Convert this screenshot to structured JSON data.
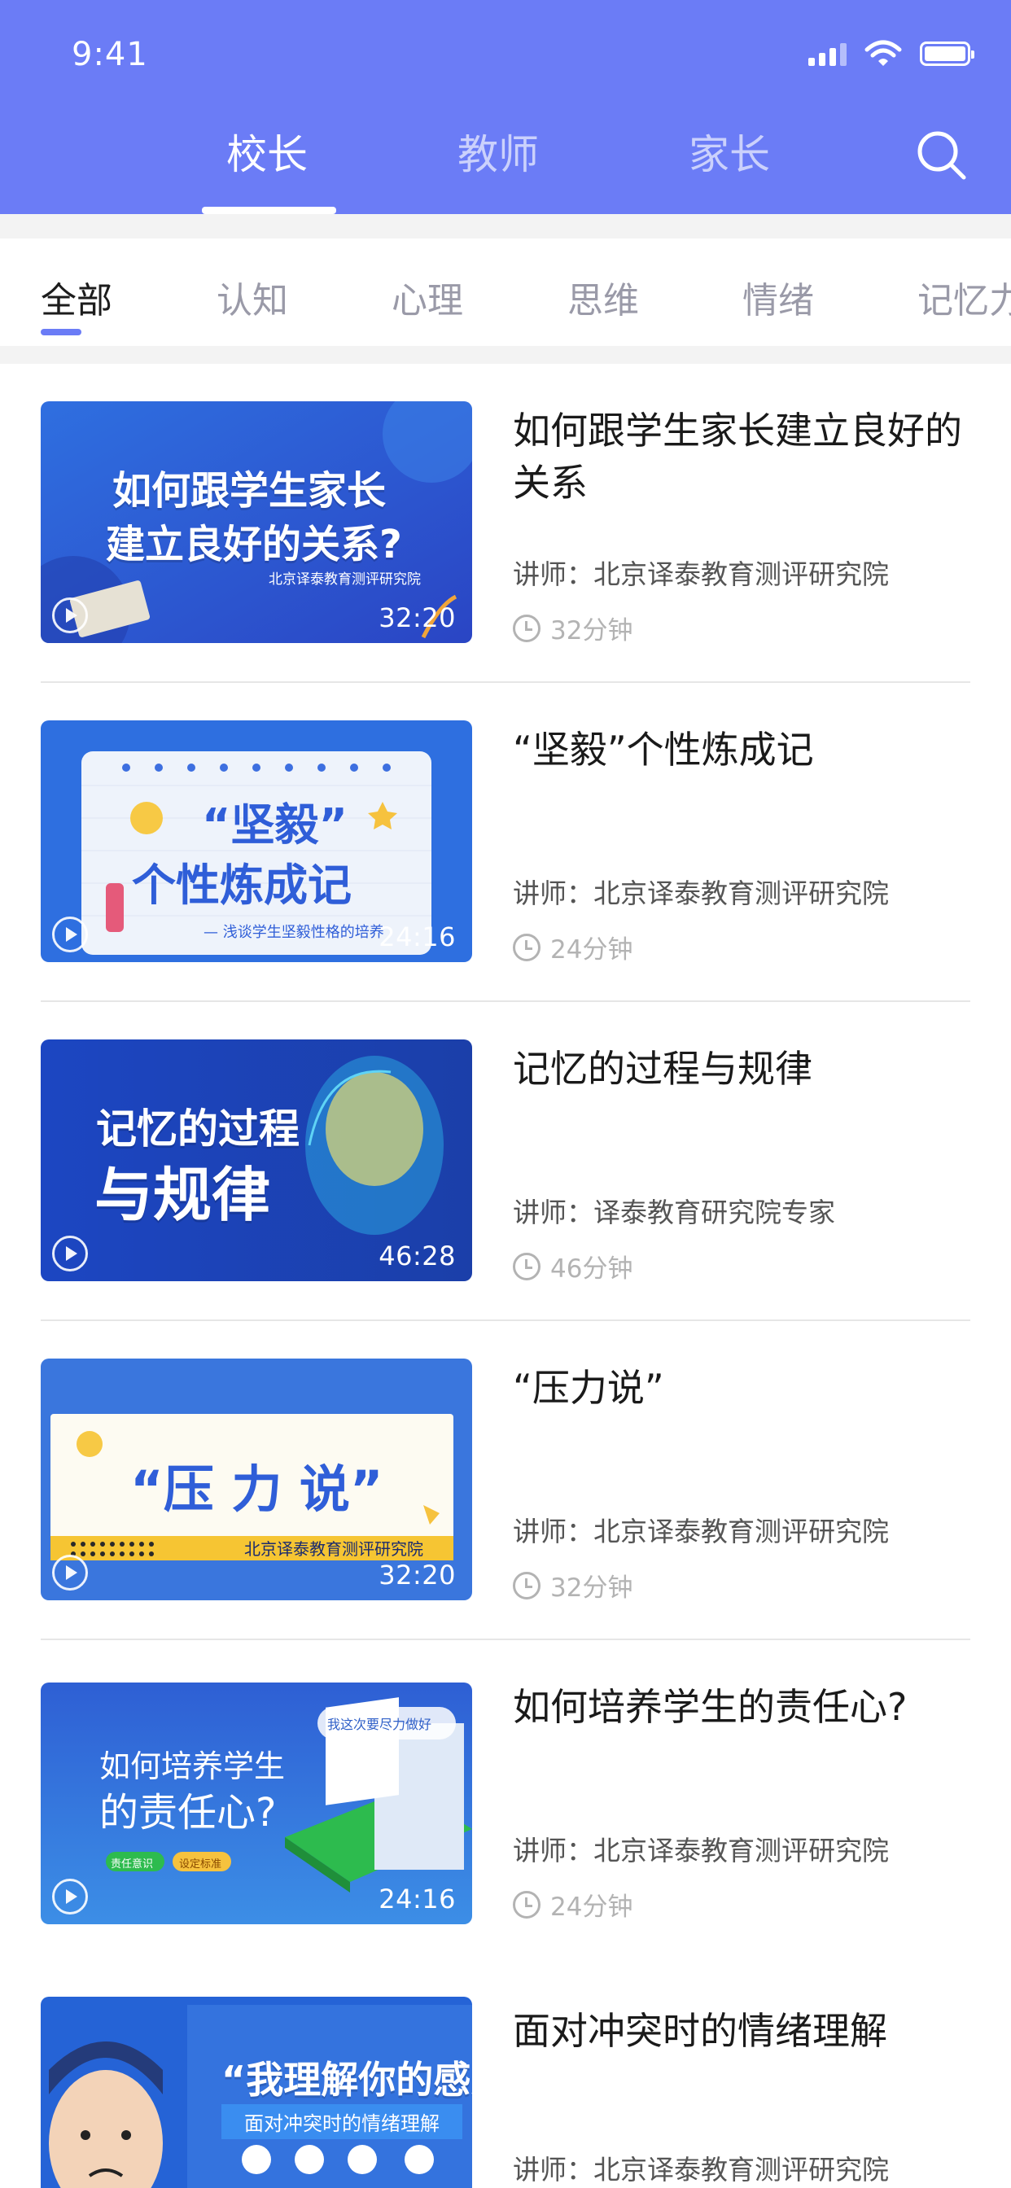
{
  "status": {
    "time": "9:41"
  },
  "header": {
    "tabs": [
      {
        "label": "校长",
        "active": true
      },
      {
        "label": "教师",
        "active": false
      },
      {
        "label": "家长",
        "active": false
      }
    ],
    "accent_color": "#6b7cf6"
  },
  "categories": [
    {
      "label": "全部",
      "active": true
    },
    {
      "label": "认知",
      "active": false
    },
    {
      "label": "心理",
      "active": false
    },
    {
      "label": "思维",
      "active": false
    },
    {
      "label": "情绪",
      "active": false
    },
    {
      "label": "记忆力",
      "active": false
    }
  ],
  "courses": [
    {
      "title": "如何跟学生家长建立良好的关系",
      "lecturer": "讲师：北京译泰教育测评研究院",
      "minutes": "32分钟",
      "duration": "32:20",
      "thumb_text": [
        "如何跟学生家长",
        "建立良好的关系?"
      ],
      "thumb_sub": "北京译泰教育测评研究院"
    },
    {
      "title": "“坚毅”个性炼成记",
      "lecturer": "讲师：北京译泰教育测评研究院",
      "minutes": "24分钟",
      "duration": "24:16",
      "thumb_text": [
        "“坚毅”",
        "个性炼成记"
      ],
      "thumb_sub": "— 浅谈学生坚毅性格的培养"
    },
    {
      "title": "记忆的过程与规律",
      "lecturer": "讲师：译泰教育研究院专家",
      "minutes": "46分钟",
      "duration": "46:28",
      "thumb_text": [
        "记忆的过程",
        "与规律"
      ],
      "thumb_sub": ""
    },
    {
      "title": "“压力说”",
      "lecturer": "讲师：北京译泰教育测评研究院",
      "minutes": "32分钟",
      "duration": "32:20",
      "thumb_text": [
        "“压 力 说”"
      ],
      "thumb_sub": "北京译泰教育测评研究院"
    },
    {
      "title": "如何培养学生的责任心?",
      "lecturer": "讲师：北京译泰教育测评研究院",
      "minutes": "24分钟",
      "duration": "24:16",
      "thumb_text": [
        "如何培养学生",
        "的责任心?"
      ],
      "thumb_sub": "我这次要尽力做好",
      "thumb_tags": [
        "责任意识",
        "设定标准"
      ]
    },
    {
      "title": "面对冲突时的情绪理解",
      "lecturer": "讲师：北京译泰教育测评研究院",
      "minutes": "",
      "duration": "",
      "thumb_text": [
        "“我理解你的感受”"
      ],
      "thumb_sub": "面对冲突时的情绪理解"
    }
  ]
}
